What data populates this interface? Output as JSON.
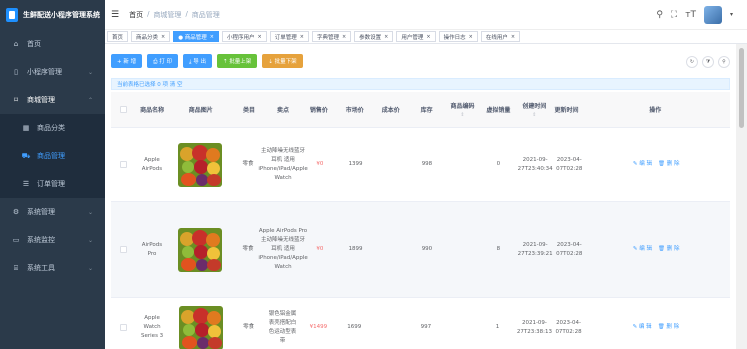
{
  "app": {
    "title": "生鲜配送小程序管理系统"
  },
  "sidebar": {
    "items": [
      {
        "icon": "home-icon",
        "label": "首页"
      },
      {
        "icon": "mobile-icon",
        "label": "小程序管理"
      },
      {
        "icon": "shop-icon",
        "label": "商城管理"
      },
      {
        "icon": "grid-icon",
        "label": "商品分类"
      },
      {
        "icon": "cart-icon",
        "label": "商品管理"
      },
      {
        "icon": "list-icon",
        "label": "订单管理"
      },
      {
        "icon": "gear-icon",
        "label": "系统管理"
      },
      {
        "icon": "monitor-icon",
        "label": "系统监控"
      },
      {
        "icon": "tool-icon",
        "label": "系统工具"
      }
    ]
  },
  "header": {
    "breadcrumb": [
      "首页",
      "/",
      "商城管理",
      "/",
      "商品管理"
    ]
  },
  "tags": [
    {
      "label": "首页",
      "active": false,
      "closable": false
    },
    {
      "label": "商品分类",
      "active": false,
      "closable": true
    },
    {
      "label": "● 商品管理",
      "active": true,
      "closable": true
    },
    {
      "label": "小程序用户",
      "active": false,
      "closable": true
    },
    {
      "label": "订单管理",
      "active": false,
      "closable": true
    },
    {
      "label": "字典管理",
      "active": false,
      "closable": true
    },
    {
      "label": "参数设置",
      "active": false,
      "closable": true
    },
    {
      "label": "用户管理",
      "active": false,
      "closable": true
    },
    {
      "label": "操作日志",
      "active": false,
      "closable": true
    },
    {
      "label": "在线用户",
      "active": false,
      "closable": true
    }
  ],
  "toolbar": {
    "add": "+ 新 增",
    "print": "⎙ 打 印",
    "export": "⤓ 导 出",
    "batch_on": "⇡ 批量上架",
    "batch_off": "⇣ 批量下架"
  },
  "selection_info": "当前表格已选择 0 项  清 空",
  "table": {
    "headers": {
      "name": "商品名称",
      "image": "商品图片",
      "category": "类目",
      "selling": "卖点",
      "price": "销售价",
      "market": "市场价",
      "cost": "成本价",
      "stock": "库存",
      "code": "商品编码",
      "sales": "虚拟销量",
      "created": "创建时间",
      "updated": "更新时间",
      "ops": "操作"
    },
    "rows": [
      {
        "name": "Apple AirPods",
        "category": "零食",
        "selling": "主动降噪无线蓝牙耳机 适用iPhone/iPad/Apple Watch",
        "price": "¥0",
        "market": "1399",
        "cost": "",
        "stock": "998",
        "code": "",
        "sales": "0",
        "created": "2021-09-27T23:40:34",
        "updated": "2023-04-07T02:28",
        "edit": "✎ 编 辑",
        "del": "🗑 删 除"
      },
      {
        "name": "AirPods Pro",
        "category": "零食",
        "selling": "Apple AirPods Pro 主动降噪无线蓝牙耳机 适用iPhone/iPad/Apple Watch",
        "price": "¥0",
        "market": "1899",
        "cost": "",
        "stock": "990",
        "code": "",
        "sales": "8",
        "created": "2021-09-27T23:39:21",
        "updated": "2023-04-07T02:28",
        "edit": "✎ 编 辑",
        "del": "🗑 删 除"
      },
      {
        "name": "Apple Watch Series 3",
        "category": "零食",
        "selling": "银色铝金属表壳搭配白色运动型表带",
        "price": "¥1499",
        "market": "1699",
        "cost": "",
        "stock": "997",
        "code": "",
        "sales": "1",
        "created": "2021-09-27T23:38:13",
        "updated": "2023-04-07T02:28",
        "edit": "✎ 编 辑",
        "del": "🗑 删 除"
      }
    ]
  }
}
